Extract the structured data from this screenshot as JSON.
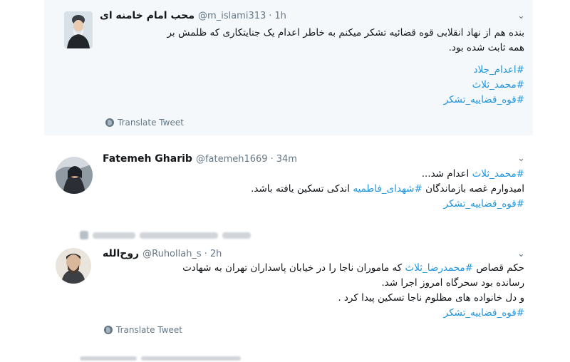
{
  "tweets": [
    {
      "name": "محب امام خامنه ای",
      "handle": "@m_islami313",
      "time": "1h",
      "lines": [
        "بنده هم از نهاد انقلابی قوه قضائیه تشکر میکنم به خاطر اعدام یک جنایتکاری که ظلمش بر",
        "همه ثابت شده بود."
      ],
      "hashtags": [
        "#اعدام_جلاد",
        "#محمد_ثلاث",
        "#قوه_قضاییه_تشکر"
      ],
      "translate": "Translate Tweet"
    },
    {
      "name": "Fatemeh Gharib",
      "handle": "@fatemeh1669",
      "time": "34m",
      "line1_tag": "#محمد_ثلاث",
      "line1_rest": " اعدام شد...",
      "line2_before": "امیدوارم غصه بازماندگان ",
      "line2_tag": "#شهدای_فاطمیه",
      "line2_after": " اندکی تسکین یافته باشد.",
      "line3_tag": "#قوه_قضاییه_تشکر"
    },
    {
      "name": "روح‌الله",
      "handle": "@Ruhollah_s",
      "time": "2h",
      "line1_before": "حکم قصاص ",
      "line1_tag": "#محمدرضا_ثلاث",
      "line1_after": " که ماموران ناجا را در خیابان پاسداران تهران به شهادت",
      "line2": "رسانده بود سحرگاه امروز اجرا شد.",
      "line3": "و دل خانواده های مظلوم ناجا تسکین پیدا کرد .",
      "line4_tag": "#قوه_قضاییه_تشکر",
      "translate": "Translate Tweet"
    }
  ],
  "icons": {
    "chevron": "chevron-down-icon",
    "globe": "globe-icon"
  },
  "colors": {
    "link": "#1b95e0",
    "secondary": "#657786",
    "highlight_bg": "#f5f8fa"
  }
}
